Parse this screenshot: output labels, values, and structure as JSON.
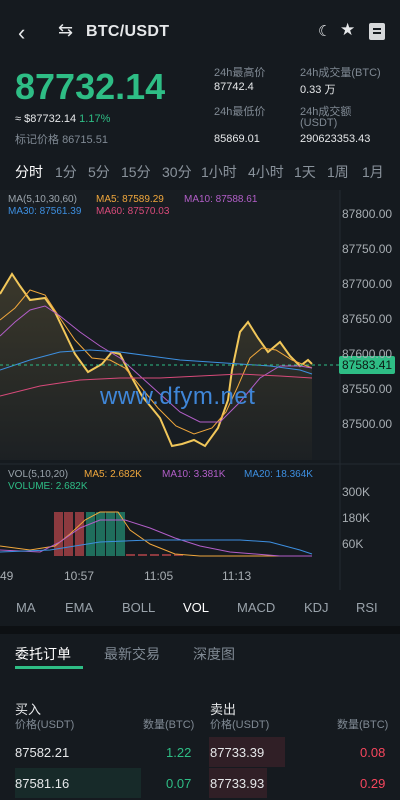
{
  "header": {
    "pair": "BTC/USDT",
    "back_icon": "chevron-left-icon",
    "swap_icon": "swap-icon"
  },
  "ticker": {
    "price": "87732.14",
    "approx_prefix": "≈",
    "approx_value": "$87732.14",
    "change": "1.17%",
    "mark_label": "标记价格",
    "mark_value": "86715.51",
    "high_label": "24h最高价",
    "high_value": "87742.4",
    "vol_btc_label": "24h成交量(BTC)",
    "vol_btc_value": "0.33 万",
    "low_label": "24h最低价",
    "low_value": "85869.01",
    "vol_usdt_label": "24h成交额",
    "vol_usdt_label2": "(USDT)",
    "vol_usdt_value": "290623353.43"
  },
  "intervals": [
    "分时",
    "1分",
    "5分",
    "15分",
    "30分",
    "1小时",
    "4小时",
    "1天",
    "1周",
    "1月"
  ],
  "ma_legend": {
    "label": "MA(5,10,30,60)",
    "ma5": "MA5: 87589.29",
    "ma10": "MA10: 87588.61",
    "ma30": "MA30: 87561.39",
    "ma60": "MA60: 87570.03"
  },
  "price_axis": [
    "87800.00",
    "87750.00",
    "87700.00",
    "87650.00",
    "87600.00",
    "87550.00",
    "87500.00"
  ],
  "current_price_tag": "87583.41",
  "watermark": "www.dfym.net",
  "vol_legend": {
    "label": "VOL(5,10,20)",
    "ma5": "MA5: 2.682K",
    "ma10": "MA10: 3.381K",
    "ma20": "MA20: 18.364K",
    "volume": "VOLUME: 2.682K"
  },
  "vol_axis": [
    "300K",
    "180K",
    "60K"
  ],
  "time_axis": [
    "49",
    "10:57",
    "11:05",
    "11:13"
  ],
  "indicators": [
    "MA",
    "EMA",
    "BOLL",
    "VOL",
    "MACD",
    "KDJ",
    "RSI"
  ],
  "tabs": [
    "委托订单",
    "最新交易",
    "深度图"
  ],
  "orderbook": {
    "buy_title": "买入",
    "sell_title": "卖出",
    "price_label": "价格(USDT)",
    "qty_label": "数量(BTC)",
    "bids": [
      {
        "price": "87582.21",
        "qty": "1.22"
      },
      {
        "price": "87581.16",
        "qty": "0.07"
      }
    ],
    "asks": [
      {
        "price": "87733.39",
        "qty": "0.08"
      },
      {
        "price": "87733.93",
        "qty": "0.29"
      }
    ]
  },
  "colors": {
    "up": "#2ebd85",
    "down": "#f6465d",
    "ma5": "#f0a73c",
    "ma10": "#b25ec8",
    "ma30": "#3d8fe0",
    "ma60": "#d84a7a",
    "price_line": "#f1c75a"
  }
}
